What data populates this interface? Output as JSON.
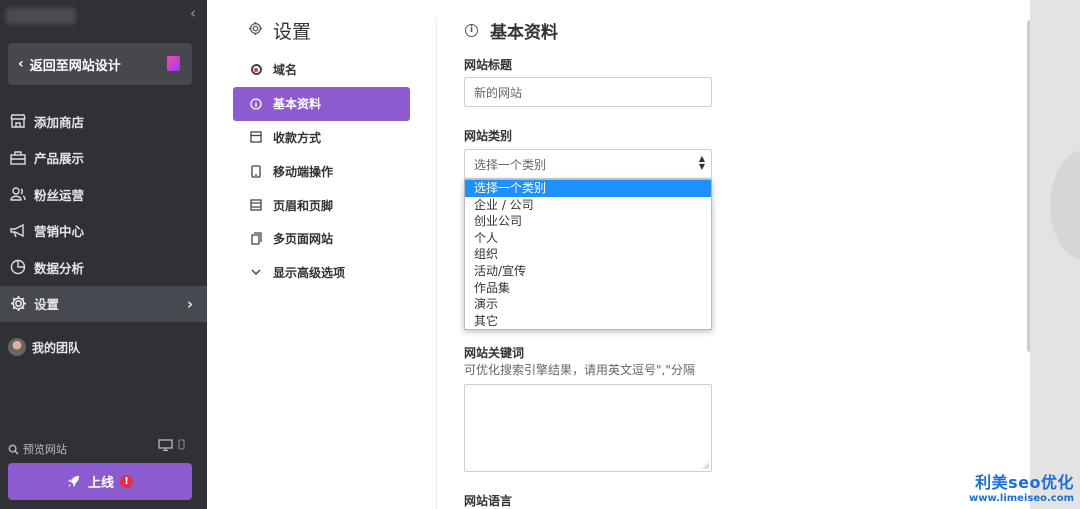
{
  "sidebar": {
    "back_label": "返回至网站设计",
    "items": [
      {
        "label": "添加商店",
        "icon": "store-icon"
      },
      {
        "label": "产品展示",
        "icon": "briefcase-icon"
      },
      {
        "label": "粉丝运营",
        "icon": "users-icon"
      },
      {
        "label": "营销中心",
        "icon": "megaphone-icon"
      },
      {
        "label": "数据分析",
        "icon": "pie-chart-icon"
      },
      {
        "label": "设置",
        "icon": "gear-icon",
        "active": true
      }
    ],
    "team_label": "我的团队",
    "preview_label": "预览网站",
    "go_live_label": "上线",
    "go_live_badge": "!",
    "accent_color": "#8c5bd0"
  },
  "settings": {
    "title": "设置",
    "nav": [
      {
        "label": "域名",
        "icon": "record-icon"
      },
      {
        "label": "基本资料",
        "icon": "info-icon",
        "active": true
      },
      {
        "label": "收款方式",
        "icon": "card-icon"
      },
      {
        "label": "移动端操作",
        "icon": "mobile-icon"
      },
      {
        "label": "页眉和页脚",
        "icon": "layout-icon"
      },
      {
        "label": "多页面网站",
        "icon": "pages-icon"
      },
      {
        "label": "显示高级选项",
        "icon": "chevron-down-icon"
      }
    ]
  },
  "form": {
    "section_title": "基本资料",
    "site_title_label": "网站标题",
    "site_title_value": "新的网站",
    "category_label": "网站类别",
    "category_selected": "选择一个类别",
    "category_options": [
      "选择一个类别",
      "企业 / 公司",
      "创业公司",
      "个人",
      "组织",
      "活动/宣传",
      "作品集",
      "演示",
      "其它"
    ],
    "keywords_label": "网站关键词",
    "keywords_hint": "可优化搜索引擎结果，请用英文逗号\",\"分隔",
    "language_label": "网站语言"
  },
  "watermark": {
    "line1": "利美seo优化",
    "line2": "www.limeiseo.com"
  }
}
